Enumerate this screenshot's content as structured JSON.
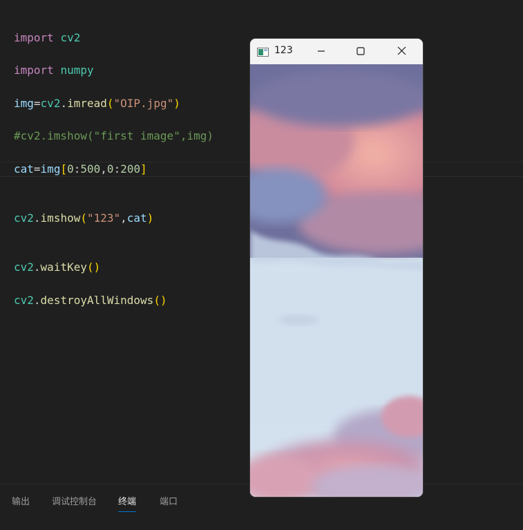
{
  "editor": {
    "lines": [
      {
        "tokens": [
          {
            "t": "import",
            "c": "kw"
          },
          {
            "t": " ",
            "c": "plain"
          },
          {
            "t": "cv2",
            "c": "mod"
          }
        ]
      },
      {
        "tokens": [
          {
            "t": "import",
            "c": "kw"
          },
          {
            "t": " ",
            "c": "plain"
          },
          {
            "t": "numpy",
            "c": "mod"
          }
        ]
      },
      {
        "tokens": [
          {
            "t": "img",
            "c": "var"
          },
          {
            "t": "=",
            "c": "op"
          },
          {
            "t": "cv2",
            "c": "mod"
          },
          {
            "t": ".",
            "c": "op"
          },
          {
            "t": "imread",
            "c": "fn"
          },
          {
            "t": "(",
            "c": "br1"
          },
          {
            "t": "\"OIP.jpg\"",
            "c": "str"
          },
          {
            "t": ")",
            "c": "br1"
          }
        ]
      },
      {
        "tokens": [
          {
            "t": "#cv2.imshow(\"first image\",img)",
            "c": "cmt"
          }
        ]
      },
      {
        "tokens": [
          {
            "t": "cat",
            "c": "var"
          },
          {
            "t": "=",
            "c": "op"
          },
          {
            "t": "img",
            "c": "var"
          },
          {
            "t": "[",
            "c": "br1"
          },
          {
            "t": "0",
            "c": "num"
          },
          {
            "t": ":",
            "c": "op"
          },
          {
            "t": "500",
            "c": "num"
          },
          {
            "t": ",",
            "c": "op"
          },
          {
            "t": "0",
            "c": "num"
          },
          {
            "t": ":",
            "c": "op"
          },
          {
            "t": "200",
            "c": "num"
          },
          {
            "t": "]",
            "c": "br1"
          }
        ]
      },
      {
        "tokens": [
          {
            "t": "cv2",
            "c": "mod"
          },
          {
            "t": ".",
            "c": "op"
          },
          {
            "t": "imshow",
            "c": "fn"
          },
          {
            "t": "(",
            "c": "br1"
          },
          {
            "t": "\"123\"",
            "c": "str"
          },
          {
            "t": ",",
            "c": "op"
          },
          {
            "t": "cat",
            "c": "var"
          },
          {
            "t": ")",
            "c": "br1"
          }
        ]
      },
      {
        "tokens": [
          {
            "t": "cv2",
            "c": "mod"
          },
          {
            "t": ".",
            "c": "op"
          },
          {
            "t": "waitKey",
            "c": "fn"
          },
          {
            "t": "()",
            "c": "br1"
          }
        ]
      },
      {
        "tokens": [
          {
            "t": "cv2",
            "c": "mod"
          },
          {
            "t": ".",
            "c": "op"
          },
          {
            "t": "destroyAllWindows",
            "c": "fn"
          },
          {
            "t": "()",
            "c": "br1"
          }
        ]
      }
    ]
  },
  "panel": {
    "tabs": [
      {
        "label": "输出",
        "active": false
      },
      {
        "label": "调试控制台",
        "active": false
      },
      {
        "label": "终端",
        "active": true
      },
      {
        "label": "端口",
        "active": false
      }
    ]
  },
  "image_window": {
    "title": "123",
    "icons": {
      "app": "opencv-window-icon",
      "minimize": "minimize-icon",
      "maximize": "maximize-icon",
      "close": "close-icon"
    },
    "image_content": "sky-with-clouds"
  },
  "colors": {
    "editor_bg": "#1f1f1f",
    "keyword": "#c586c0",
    "module": "#4ec9b0",
    "variable": "#9cdcfe",
    "function": "#dcdcaa",
    "string": "#ce9178",
    "number": "#b5cea8",
    "comment": "#6a9955",
    "bracket": "#ffd700",
    "active_tab_underline": "#0078d4"
  }
}
